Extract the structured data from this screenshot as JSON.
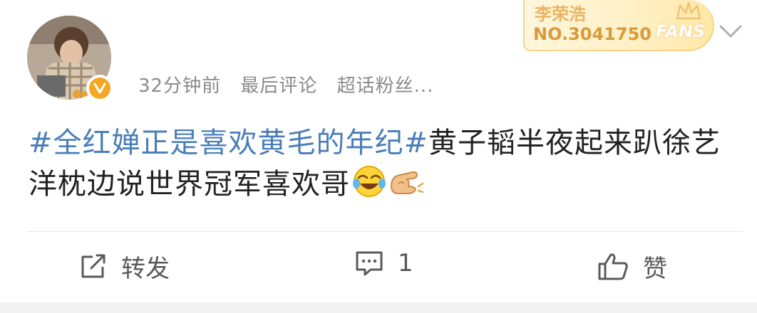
{
  "header": {
    "meta": {
      "time": "32分钟前",
      "last_comment": "最后评论",
      "group": "超话粉丝..."
    },
    "fans_badge": {
      "name": "李荣浩",
      "number": "NO.3041750",
      "tag": "FANS"
    }
  },
  "post": {
    "topic": "#全红婵正是喜欢黄毛的年纪#",
    "text": "黄子韬半夜起来趴徐艺洋枕边说世界冠军喜欢哥",
    "emojis": [
      "laugh-cry-emoji",
      "pointing-hand-emoji"
    ]
  },
  "actions": {
    "repost_label": "转发",
    "comment_count": "1",
    "like_label": "赞"
  },
  "colors": {
    "topic": "#4a7eb8",
    "meta": "#8a8a8a",
    "verified": "#f5a623",
    "badge_gold": "#d99a3c"
  }
}
